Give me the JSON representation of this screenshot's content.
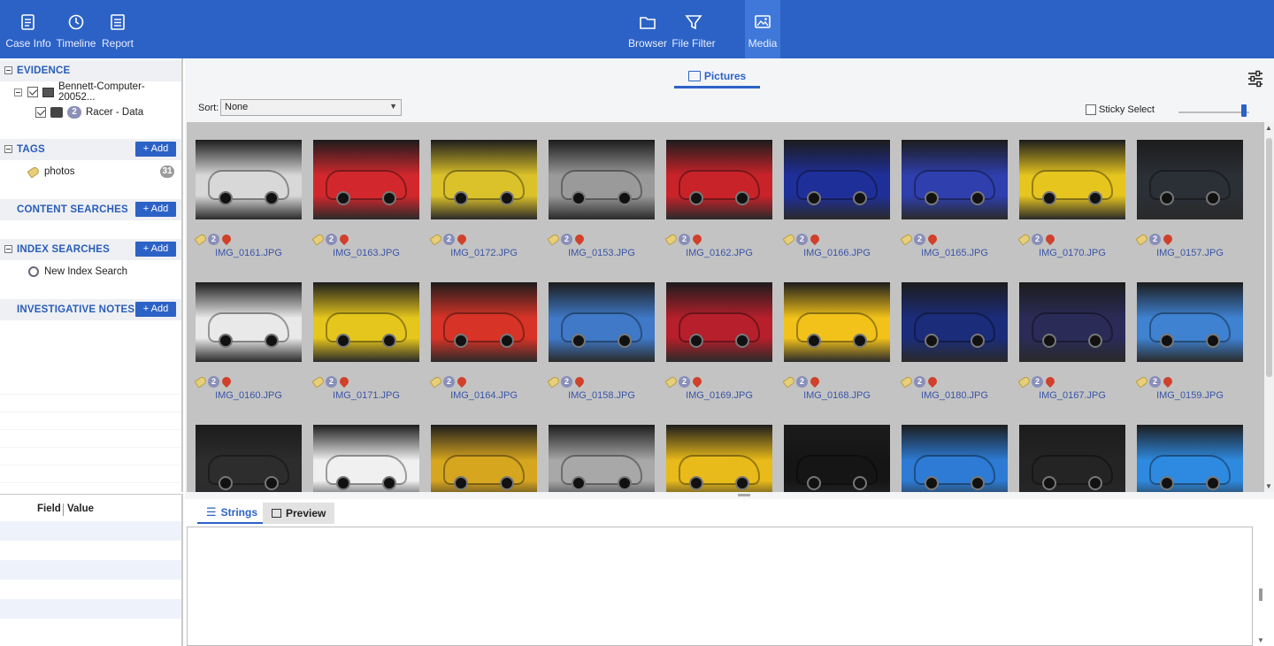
{
  "toolbar": {
    "left": [
      {
        "label": "Case Info",
        "icon": "case-info-icon"
      },
      {
        "label": "Timeline",
        "icon": "timeline-icon"
      },
      {
        "label": "Report",
        "icon": "report-icon"
      }
    ],
    "center": [
      {
        "label": "Browser",
        "icon": "folder-icon"
      },
      {
        "label": "File Filter",
        "icon": "filter-icon"
      },
      {
        "label": "Media",
        "icon": "media-icon",
        "active": true
      }
    ]
  },
  "left": {
    "evidence": {
      "title": "EVIDENCE",
      "computer": "Bennett-Computer-20052...",
      "source_count": "2",
      "source": "Racer - Data"
    },
    "tags": {
      "title": "TAGS",
      "add": "+ Add",
      "item": "photos",
      "count": "31"
    },
    "content_searches": {
      "title": "CONTENT SEARCHES",
      "add": "+ Add"
    },
    "index_searches": {
      "title": "INDEX SEARCHES",
      "add": "+ Add",
      "item": "New Index Search"
    },
    "notes": {
      "title": "INVESTIGATIVE NOTES",
      "add": "+ Add"
    },
    "props": {
      "field": "Field",
      "value": "Value"
    }
  },
  "main": {
    "tab": "Pictures",
    "sort_label": "Sort:",
    "sort_value": "None",
    "sticky_select": "Sticky Select",
    "zoom_level": 0.92,
    "badge_count": "2",
    "files": [
      "IMG_0161.JPG",
      "IMG_0163.JPG",
      "IMG_0172.JPG",
      "IMG_0153.JPG",
      "IMG_0162.JPG",
      "IMG_0166.JPG",
      "IMG_0165.JPG",
      "IMG_0170.JPG",
      "IMG_0157.JPG",
      "IMG_0160.JPG",
      "IMG_0171.JPG",
      "IMG_0164.JPG",
      "IMG_0158.JPG",
      "IMG_0169.JPG",
      "IMG_0168.JPG",
      "IMG_0180.JPG",
      "IMG_0167.JPG",
      "IMG_0159.JPG"
    ],
    "thumb_colors": [
      "#d8d8d8",
      "#d2282d",
      "#dcc22a",
      "#9a9a9a",
      "#c9232a",
      "#1f2f9a",
      "#2f3fae",
      "#e6c51f",
      "#2b2f36",
      "#e9e9e9",
      "#e5c61c",
      "#d73326",
      "#3f79c7",
      "#b61f2b",
      "#f2c21a",
      "#1b2c7a",
      "#2a2b57",
      "#3e82d1",
      "#2d2d2d",
      "#f0f0f0",
      "#d7a61f",
      "#a8a8a8",
      "#e9bb1a",
      "#151515",
      "#2d7bd4",
      "#242424",
      "#2e8ae0"
    ]
  },
  "bottom": {
    "tabs": [
      {
        "label": "Strings",
        "active": true
      },
      {
        "label": "Preview",
        "active": false
      }
    ]
  }
}
